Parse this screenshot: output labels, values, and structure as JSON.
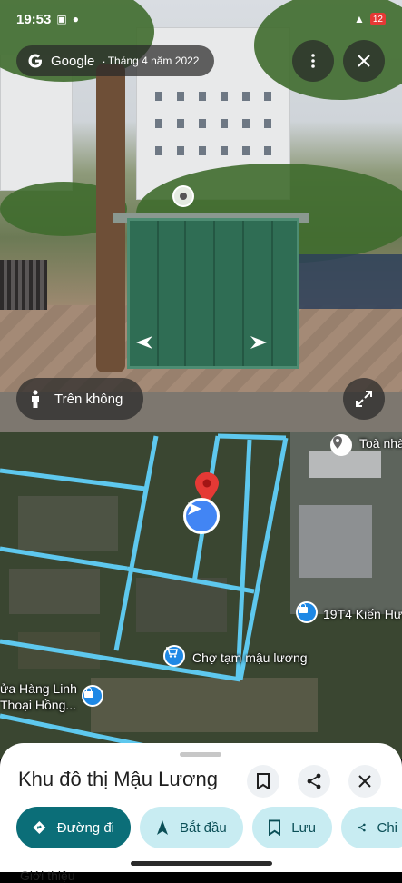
{
  "status_bar": {
    "time": "19:53",
    "battery": "12"
  },
  "street_view": {
    "brand": "Google",
    "separator": "·",
    "date": "Tháng 4 năm 2022",
    "aerial_label": "Trên không",
    "icons": {
      "google": "google-g-icon",
      "more": "more-vert-icon",
      "close": "close-icon",
      "expand": "expand-icon",
      "person": "person-icon",
      "left": "chevron-left-icon",
      "right": "chevron-right-icon"
    }
  },
  "map": {
    "labels": {
      "toa_nha": "Toà nhà",
      "kien_hung": "19T4 Kiến Hư",
      "cho_tam": "Chợ tạm mậu lương",
      "hang_linh_1": "ửa Hàng Linh",
      "hang_linh_2": "Thoại Hồng..."
    },
    "colors": {
      "road": "#5ec8ee",
      "pin": "#e53935",
      "location": "#4285f4"
    }
  },
  "sheet": {
    "title": "Khu đô thị Mậu Lương",
    "actions": {
      "directions": "Đường đi",
      "start": "Bắt đầu",
      "save": "Lưu",
      "share": "Chi"
    },
    "peek": "Giới thiệu",
    "colors": {
      "primary": "#0b6e78",
      "secondary": "#c8ecf2"
    }
  }
}
